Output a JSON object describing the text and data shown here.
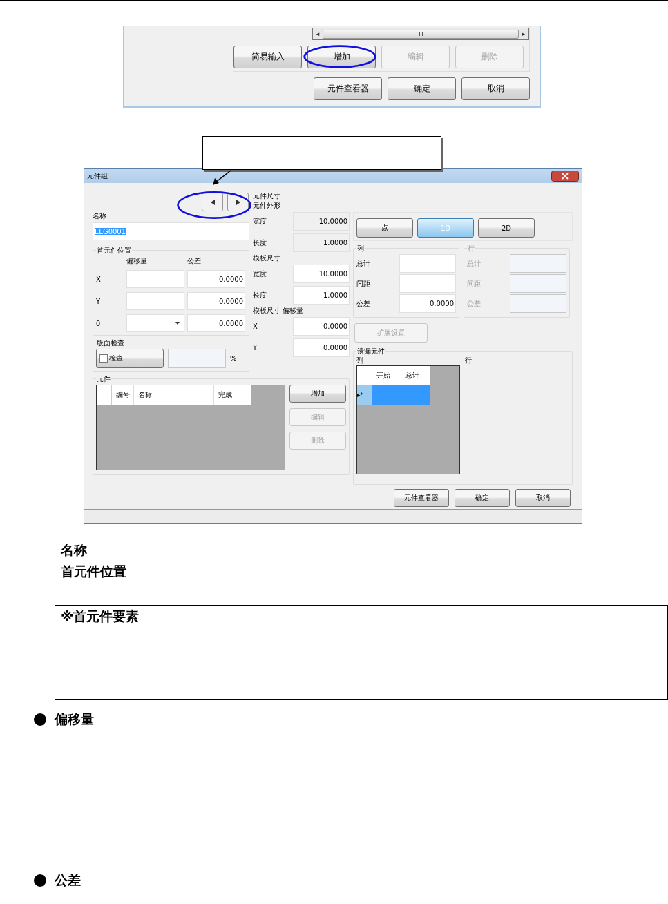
{
  "top_dialog": {
    "buttons": [
      {
        "label": "简易输入",
        "disabled": false,
        "circled": false
      },
      {
        "label": "增加",
        "disabled": false,
        "circled": true
      },
      {
        "label": "编辑",
        "disabled": true,
        "circled": false
      },
      {
        "label": "删除",
        "disabled": true,
        "circled": false
      }
    ],
    "scroll_left": "◂",
    "scroll_right": "▸",
    "bottom_buttons": [
      "元件查看器",
      "确定",
      "取消"
    ]
  },
  "dialog": {
    "title": "元件组",
    "name_label": "名称",
    "name_value": "ELG0001",
    "first_position": {
      "title": "首元件位置",
      "col_offset": "偏移量",
      "col_tolerance": "公差",
      "rows": [
        {
          "label": "X",
          "kind": "text",
          "tolerance": "0.0000"
        },
        {
          "label": "Y",
          "kind": "text",
          "tolerance": "0.0000"
        },
        {
          "label": "θ",
          "kind": "dropdown",
          "tolerance": "0.0000"
        }
      ]
    },
    "board_check": {
      "title": "版面检查",
      "checkbox_label": "检查",
      "checked": false,
      "unit": "%"
    },
    "elements": {
      "title": "元件",
      "columns": [
        "编号",
        "名称",
        "完成"
      ],
      "buttons": [
        {
          "label": "增加",
          "disabled": false
        },
        {
          "label": "编辑",
          "disabled": true
        },
        {
          "label": "删除",
          "disabled": true
        }
      ]
    },
    "size": {
      "title": "元件尺寸",
      "shape_title": "元件外形",
      "shape": [
        {
          "label": "宽度",
          "value": "10.0000",
          "readonly": true
        },
        {
          "label": "长度",
          "value": "1.0000",
          "readonly": true
        }
      ],
      "template_title": "模板尺寸",
      "template": [
        {
          "label": "宽度",
          "value": "10.0000",
          "readonly": false
        },
        {
          "label": "长度",
          "value": "1.0000",
          "readonly": false
        }
      ],
      "offset_title": "模板尺寸 偏移量",
      "offset": [
        {
          "label": "X",
          "value": "0.0000",
          "readonly": false
        },
        {
          "label": "Y",
          "value": "0.0000",
          "readonly": false
        }
      ]
    },
    "mode_buttons": [
      {
        "label": "点",
        "selected": false
      },
      {
        "label": "1D",
        "selected": true
      },
      {
        "label": "2D",
        "selected": false
      }
    ],
    "column": {
      "title": "列",
      "disabled": false,
      "fields": [
        {
          "label": "总计"
        },
        {
          "label": "间距"
        },
        {
          "label": "公差",
          "value": "0.0000"
        }
      ]
    },
    "row": {
      "title": "行",
      "disabled": true,
      "fields": [
        {
          "label": "总计"
        },
        {
          "label": "间距"
        },
        {
          "label": "公差"
        }
      ]
    },
    "ext_button": {
      "label": "扩展设置",
      "disabled": true
    },
    "missing": {
      "title": "遗漏元件",
      "column_label": "列",
      "row_label": "行",
      "columns": [
        "开始",
        "总计"
      ],
      "row_marker": "▸*",
      "row_selected": true
    },
    "buttons": [
      "元件查看器",
      "确定",
      "取消"
    ]
  },
  "notes": [
    "名称",
    "首元件位置"
  ],
  "box_title": "※首元件要素",
  "bullets": [
    "偏移量",
    "公差"
  ]
}
